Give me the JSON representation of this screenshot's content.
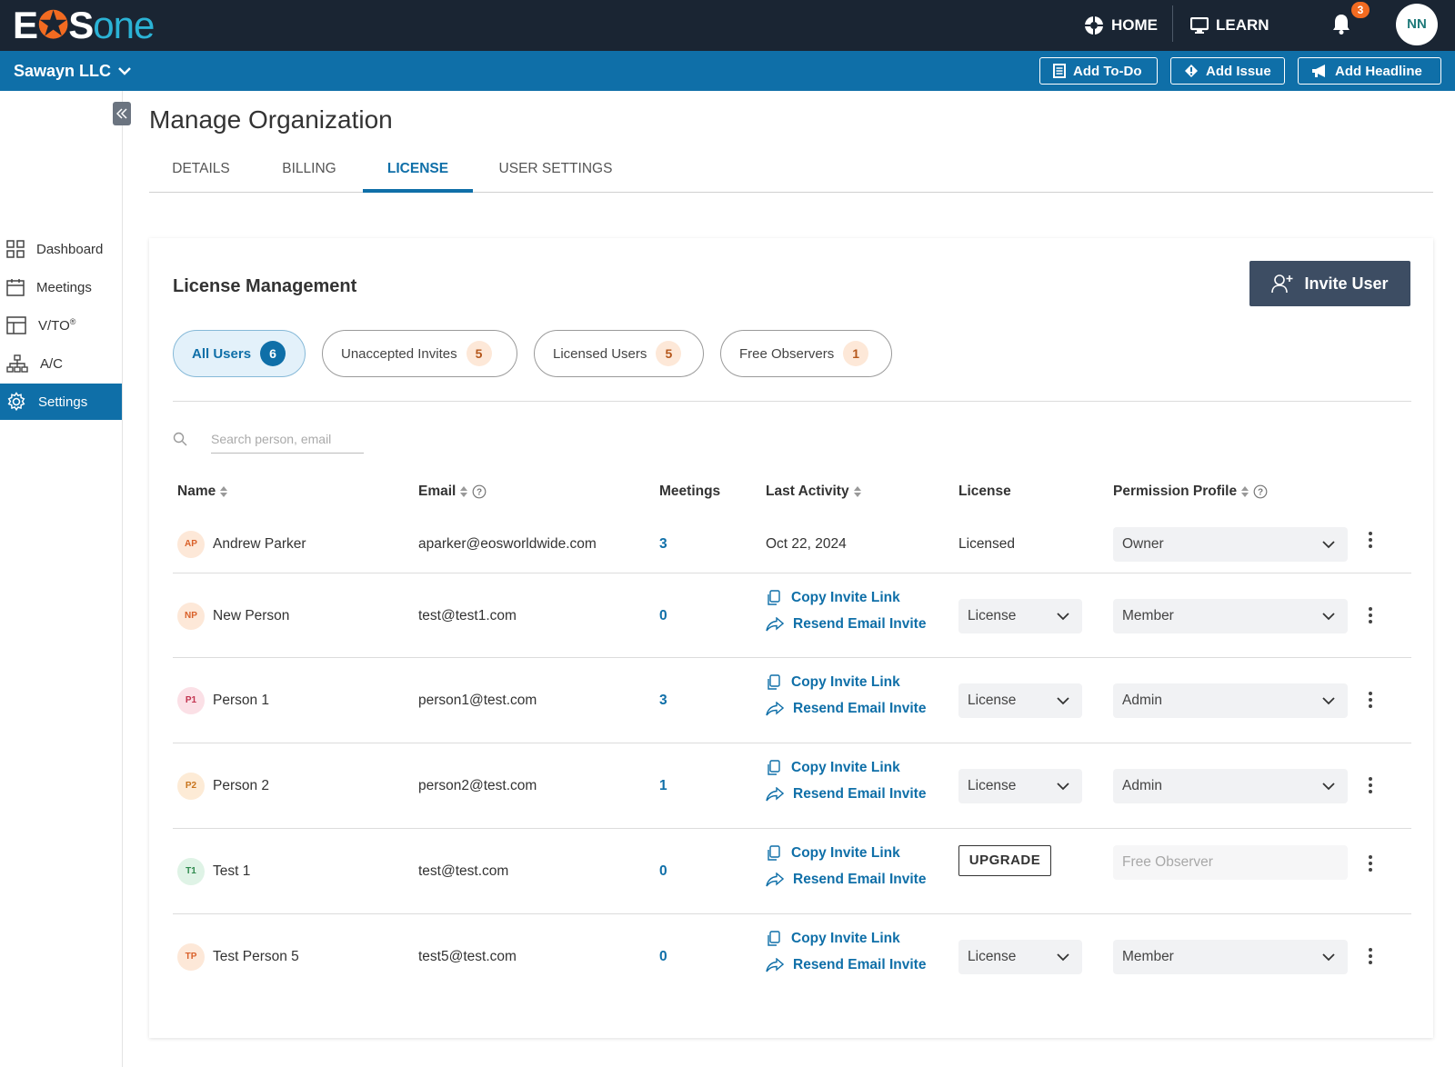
{
  "brand": {
    "part1": "E",
    "part2": "OS",
    "part3": "one"
  },
  "topnav": {
    "home": "HOME",
    "learn": "LEARN",
    "notifications": "3",
    "user_initials": "NN"
  },
  "org": {
    "name": "Sawayn LLC"
  },
  "actions": {
    "add_todo": "Add To-Do",
    "add_issue": "Add Issue",
    "add_headline": "Add Headline"
  },
  "sidebar": {
    "items": [
      {
        "label": "Dashboard"
      },
      {
        "label": "Meetings"
      },
      {
        "label": "V/TO",
        "sup": "®"
      },
      {
        "label": "A/C"
      },
      {
        "label": "Settings"
      }
    ]
  },
  "page": {
    "title": "Manage Organization"
  },
  "tabs": [
    "DETAILS",
    "BILLING",
    "LICENSE",
    "USER SETTINGS"
  ],
  "card": {
    "title": "License Management",
    "invite_label": "Invite User"
  },
  "filters": [
    {
      "label": "All Users",
      "count": "6"
    },
    {
      "label": "Unaccepted Invites",
      "count": "5"
    },
    {
      "label": "Licensed Users",
      "count": "5"
    },
    {
      "label": "Free Observers",
      "count": "1"
    }
  ],
  "search": {
    "placeholder": "Search person, email"
  },
  "columns": {
    "name": "Name",
    "email": "Email",
    "meetings": "Meetings",
    "last_activity": "Last Activity",
    "license": "License",
    "permission": "Permission Profile"
  },
  "links": {
    "copy": "Copy Invite Link",
    "resend": "Resend Email Invite"
  },
  "upgrade_label": "UPGRADE",
  "rows": [
    {
      "initials": "AP",
      "name": "Andrew Parker",
      "email": "aparker@eosworldwide.com",
      "meetings": "3",
      "last_activity": "Oct 22, 2024",
      "license": "Licensed",
      "permission": "Owner"
    },
    {
      "initials": "NP",
      "name": "New Person",
      "email": "test@test1.com",
      "meetings": "0",
      "license": "License",
      "permission": "Member"
    },
    {
      "initials": "P1",
      "name": "Person 1",
      "email": "person1@test.com",
      "meetings": "3",
      "license": "License",
      "permission": "Admin"
    },
    {
      "initials": "P2",
      "name": "Person 2",
      "email": "person2@test.com",
      "meetings": "1",
      "license": "License",
      "permission": "Admin"
    },
    {
      "initials": "T1",
      "name": "Test 1",
      "email": "test@test.com",
      "meetings": "0",
      "license": "UPGRADE",
      "permission": "Free Observer"
    },
    {
      "initials": "TP",
      "name": "Test Person 5",
      "email": "test5@test.com",
      "meetings": "0",
      "license": "License",
      "permission": "Member"
    }
  ],
  "colors": {
    "topbar": "#1a2533",
    "brand_blue": "#0f6fa8",
    "accent_orange": "#f26b21",
    "invite_button": "#3d4d63"
  }
}
